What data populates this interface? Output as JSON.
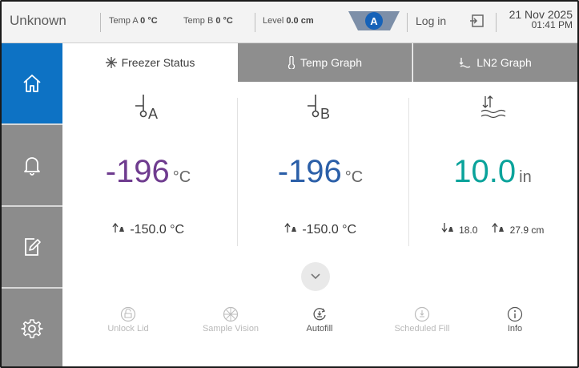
{
  "status_bar": {
    "device": "Unknown",
    "temp_a": {
      "label": "Temp A",
      "value": "0 °C"
    },
    "temp_b": {
      "label": "Temp B",
      "value": "0 °C"
    },
    "level": {
      "label": "Level",
      "value": "0.0 cm"
    },
    "badge_letter": "A",
    "login": "Log in",
    "date": "21 Nov 2025",
    "time": "01:41 PM"
  },
  "sidebar": {
    "items": [
      {
        "icon": "home-icon",
        "active": true
      },
      {
        "icon": "bell-icon",
        "active": false
      },
      {
        "icon": "edit-icon",
        "active": false
      },
      {
        "icon": "gear-icon",
        "active": false
      }
    ]
  },
  "tabs": [
    {
      "label": "Freezer Status",
      "icon": "snowflake-icon",
      "active": true
    },
    {
      "label": "Temp Graph",
      "icon": "thermometer-icon",
      "active": false
    },
    {
      "label": "LN2 Graph",
      "icon": "level-icon",
      "active": false
    }
  ],
  "sensors": {
    "temp_a": {
      "sub": "A",
      "value": "-196",
      "unit": "°C",
      "alarm": "-150.0 °C",
      "color": "#6f3c8f"
    },
    "temp_b": {
      "sub": "B",
      "value": "-196",
      "unit": "°C",
      "alarm": "-150.0 °C",
      "color": "#2b5fa8"
    },
    "level": {
      "value": "10.0",
      "unit": "in",
      "low_alarm": "18.0",
      "high_alarm": "27.9 cm",
      "color": "#0aa39b"
    }
  },
  "actions": [
    {
      "label": "Unlock Lid",
      "enabled": false
    },
    {
      "label": "Sample Vision",
      "enabled": false
    },
    {
      "label": "Autofill",
      "enabled": true
    },
    {
      "label": "Scheduled Fill",
      "enabled": false
    },
    {
      "label": "Info",
      "enabled": true
    }
  ],
  "colors": {
    "accent": "#0d72c4",
    "sidebar": "#8c8c8c",
    "tab_inactive": "#8e8e8e"
  }
}
